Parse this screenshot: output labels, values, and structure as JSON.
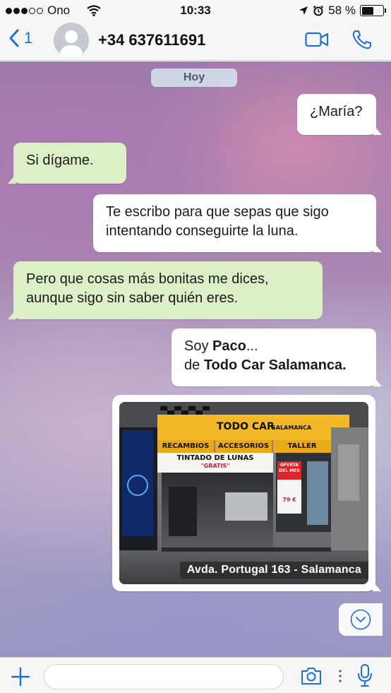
{
  "status_bar": {
    "carrier": "Ono",
    "time": "10:33",
    "battery": "58 %",
    "battery_level": 0.58,
    "signal_bars_filled": 3,
    "signal_bars_total": 5
  },
  "header": {
    "back_count": "1",
    "contact": "+34 637611691",
    "accent_color": "#1f6fd8"
  },
  "chat": {
    "day_label": "Hoy",
    "messages": [
      {
        "direction": "out",
        "text": "¿María?"
      },
      {
        "direction": "in",
        "text": "Si dígame."
      },
      {
        "direction": "out",
        "line1": "Te escribo para que sepas que sigo",
        "line2": "intentando conseguirte la luna."
      },
      {
        "direction": "in",
        "line1": "Pero que cosas más bonitas me dices,",
        "line2": "aunque sigo sin saber quién eres."
      },
      {
        "direction": "out",
        "line1_plain": "Soy ",
        "line1_bold": "Paco",
        "line1_end": "...",
        "line2_plain": "de ",
        "line2_bold": "Todo Car Salamanca."
      }
    ],
    "photo": {
      "caption": "Avda. Portugal 163 - Salamanca",
      "sign_main": "TODO CAR",
      "sign_sub": "SALAMANCA",
      "signs": [
        "RECAMBIOS",
        "ACCESORIOS",
        "TALLER"
      ],
      "banner_title": "TINTADO DE LUNAS",
      "banner_sub": "\"GRATIS\"",
      "offer_label": "OFERTA DEL MES",
      "offer_price": "79 €"
    }
  },
  "input": {
    "placeholder": ""
  },
  "colors": {
    "outgoing_bubble": "#ffffff",
    "incoming_bubble": "#dcefc6",
    "sign_yellow": "#f2b928"
  }
}
